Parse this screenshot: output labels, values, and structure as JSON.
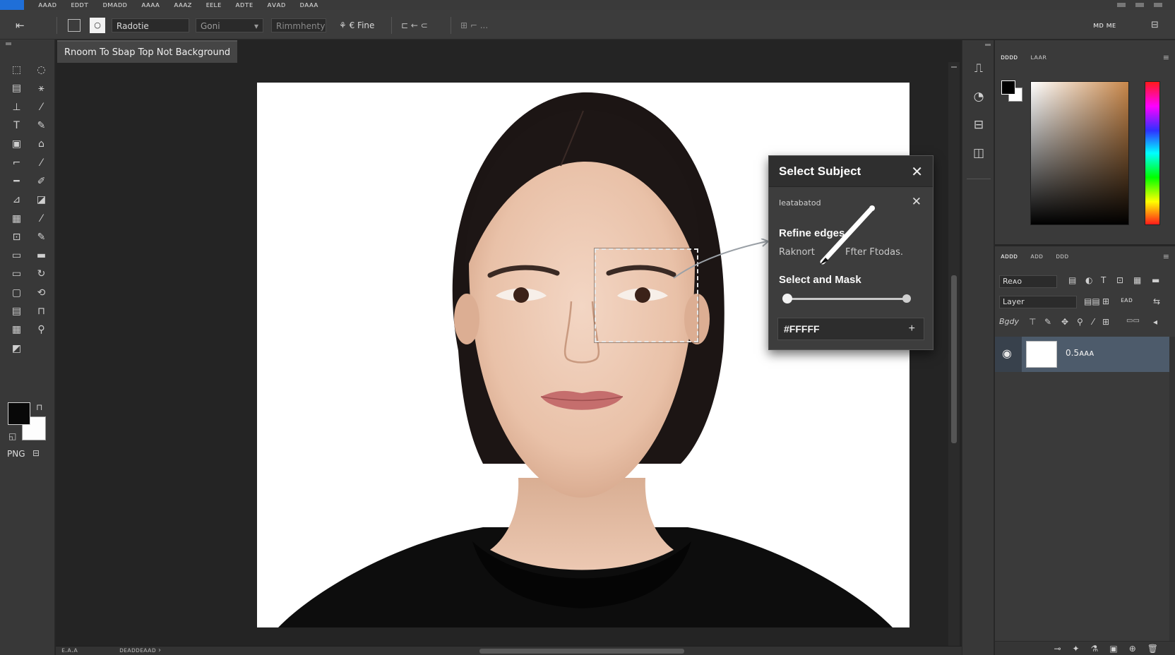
{
  "menubar": {
    "items": [
      "ᴀᴀᴀᴅ",
      "ᴇᴅᴅᴛ",
      "ᴅᴍᴀᴅᴅ",
      "ᴀᴀᴀᴀ",
      "ᴀᴀᴀᴢ",
      "ᴇᴇʟᴇ",
      "ᴀᴅᴛᴇ",
      "ᴀᴠᴀᴅ",
      "ᴅᴀᴀᴀ"
    ]
  },
  "options_bar": {
    "back_icon": "back-arrow-icon",
    "style_field": "Radotie",
    "dropdown_value": "Goni",
    "dim_field": "Rimmhenty",
    "refine_label": "€ Fine",
    "select_label": "⊏ ← ⊂",
    "extra_label": "⊞ ⌐ ...",
    "workspace_label": "ᴍᴅ ᴍᴇ"
  },
  "toolbox": {
    "tools": [
      {
        "icon": "marquee-icon",
        "glyph": "⬚"
      },
      {
        "icon": "lasso-icon",
        "glyph": "◌"
      },
      {
        "icon": "quick-select-icon",
        "glyph": "▤"
      },
      {
        "icon": "magic-wand-icon",
        "glyph": "⚹"
      },
      {
        "icon": "crop-icon",
        "glyph": "⊥"
      },
      {
        "icon": "slice-icon",
        "glyph": "⁄"
      },
      {
        "icon": "type-icon",
        "glyph": "T"
      },
      {
        "icon": "heal-icon",
        "glyph": "✎"
      },
      {
        "icon": "frame-icon",
        "glyph": "▣"
      },
      {
        "icon": "stamp-icon",
        "glyph": "⌂"
      },
      {
        "icon": "ruler-icon",
        "glyph": "⌐"
      },
      {
        "icon": "brush-icon",
        "glyph": "⁄"
      },
      {
        "icon": "line-icon",
        "glyph": "━"
      },
      {
        "icon": "pencil-icon",
        "glyph": "✐"
      },
      {
        "icon": "pen-icon",
        "glyph": "⊿"
      },
      {
        "icon": "eraser-icon",
        "glyph": "◪"
      },
      {
        "icon": "gradient-icon",
        "glyph": "▦"
      },
      {
        "icon": "dropper-icon",
        "glyph": "⁄"
      },
      {
        "icon": "shape-icon",
        "glyph": "⊡"
      },
      {
        "icon": "smudge-icon",
        "glyph": "✎"
      },
      {
        "icon": "path-icon",
        "glyph": "▭"
      },
      {
        "icon": "burn-icon",
        "glyph": "▬"
      },
      {
        "icon": "rect-icon",
        "glyph": "▭"
      },
      {
        "icon": "hand-rotate-icon",
        "glyph": "↻"
      },
      {
        "icon": "note-icon",
        "glyph": "▢"
      },
      {
        "icon": "rotate-icon",
        "glyph": "⟲"
      },
      {
        "icon": "count-icon",
        "glyph": "▤"
      },
      {
        "icon": "artboard-icon",
        "glyph": "⊓"
      },
      {
        "icon": "grid-icon",
        "glyph": "▦"
      },
      {
        "icon": "zoom-icon",
        "glyph": "⚲"
      },
      {
        "icon": "mask-icon",
        "glyph": "◩"
      }
    ],
    "format_label": "PNG"
  },
  "document": {
    "tab_title": "Rnoom To Sbap Top Not Background",
    "status_left": "ᴇ.ᴀ.ᴀ",
    "status_mid": "ᴅᴇᴀᴅᴅᴇᴀᴀᴅ ›"
  },
  "popup": {
    "title": "Select Subject",
    "subtitle": "Ieatabatod",
    "refine_label": "Refine edges",
    "refine_left": "Raknort",
    "refine_right": "Ffter Ftodas.",
    "mask_label": "Select and Mask",
    "slider_value": 0,
    "color_value": "#FFFFF"
  },
  "colors": {
    "fg": "#000000",
    "bg": "#ffffff",
    "panel": "#3a3a3a",
    "layer_selected": "#4d5b6b"
  },
  "right_panels": {
    "color_tabs": [
      "ᴅᴅᴅᴅ",
      "ʟᴀᴀʀ"
    ],
    "layer_tabs": [
      "ᴀᴅᴅᴅ",
      "ᴀᴅᴅ",
      "ᴅᴅᴅ"
    ],
    "search_placeholder": "Reᴀo",
    "blend_label": "Layer",
    "lock_label": "Bgdy",
    "layer_name": "0.5ᴀᴀᴀ",
    "opacity_label": "ᴇᴀᴅ"
  }
}
